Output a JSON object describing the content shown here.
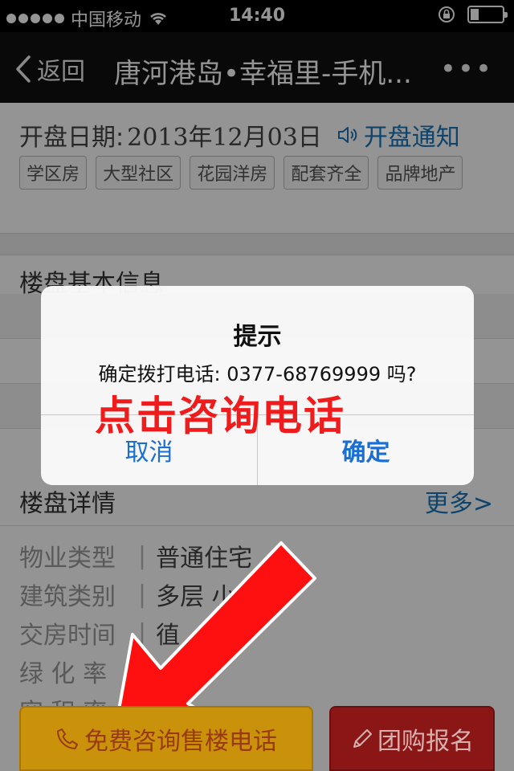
{
  "status_bar": {
    "carrier": "中国移动",
    "time": "14:40",
    "battery_level": 0.25
  },
  "nav": {
    "back_label": "返回",
    "title": "唐河港岛•幸福里-手机...",
    "more_label": "•••"
  },
  "open_info": {
    "label": "开盘日期:",
    "date": "2013年12月03日",
    "notify_label": "开盘通知"
  },
  "tags": [
    "学区房",
    "大型社区",
    "花园洋房",
    "配套齐全",
    "品牌地产"
  ],
  "basic_info": {
    "title": "楼盘基本信息"
  },
  "details": {
    "title": "楼盘详情",
    "more_label": "更多>",
    "items": [
      {
        "key": "物业类型",
        "value": "普通住宅"
      },
      {
        "key": "建筑类别",
        "value": "多层 小"
      },
      {
        "key": "交房时间",
        "value": "徝"
      },
      {
        "key": "绿 化 率",
        "value": ""
      },
      {
        "key": "容 积 率",
        "value": ""
      }
    ]
  },
  "alert": {
    "title": "提示",
    "message": "确定拨打电话: 0377-68769999 吗?",
    "cancel_label": "取消",
    "ok_label": "确定"
  },
  "annotation_text": "点击咨询电话",
  "bottom": {
    "call_label": "免费咨询售楼电话",
    "group_label": "团购报名"
  },
  "colors": {
    "accent_blue": "#1976b8",
    "alert_button_blue": "#1a6fd0",
    "annotation_red": "#ee1c1c",
    "call_button": "#c9920a",
    "group_button": "#8a1616"
  }
}
